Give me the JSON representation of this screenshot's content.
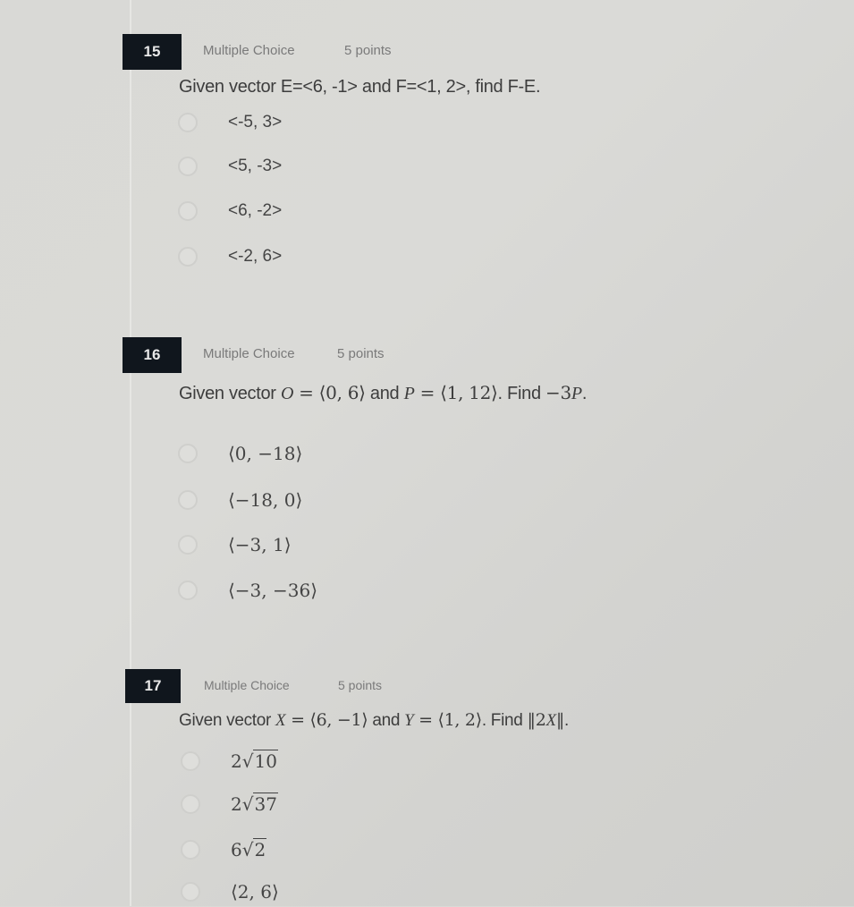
{
  "questions": [
    {
      "number": "15",
      "type": "Multiple Choice",
      "points": "5 points",
      "prompt": "Given vector E=<6, -1> and F=<1, 2>, find F-E.",
      "options": [
        "<-5, 3>",
        "<5, -3>",
        "<6, -2>",
        "<-2, 6>"
      ]
    },
    {
      "number": "16",
      "type": "Multiple Choice",
      "points": "5 points",
      "prompt_parts": {
        "lead": "Given vector ",
        "v1_name": "O",
        "eq1": " = ",
        "v1_value": "⟨0, 6⟩",
        "and": " and ",
        "v2_name": "P",
        "eq2": " = ",
        "v2_value": "⟨1, 12⟩",
        "find": ". Find ",
        "expr": "−3",
        "expr_var": "P",
        "end": "."
      },
      "options": [
        "⟨0, −18⟩",
        "⟨−18, 0⟩",
        "⟨−3, 1⟩",
        "⟨−3, −36⟩"
      ]
    },
    {
      "number": "17",
      "type": "Multiple Choice",
      "points": "5 points",
      "prompt_parts": {
        "lead": "Given vector ",
        "v1_name": "X",
        "eq1": " = ",
        "v1_value": "⟨6, −1⟩",
        "and": " and ",
        "v2_name": "Y",
        "eq2": " = ",
        "v2_value": "⟨1, 2⟩",
        "find": ". Find ",
        "norm_open": "‖2",
        "norm_var": "X",
        "norm_close": "‖",
        "end": "."
      },
      "options": [
        {
          "coef": "2",
          "radicand": "10"
        },
        {
          "coef": "2",
          "radicand": "37"
        },
        {
          "coef": "6",
          "radicand": "2"
        },
        {
          "text": "⟨2, 6⟩"
        }
      ]
    }
  ]
}
